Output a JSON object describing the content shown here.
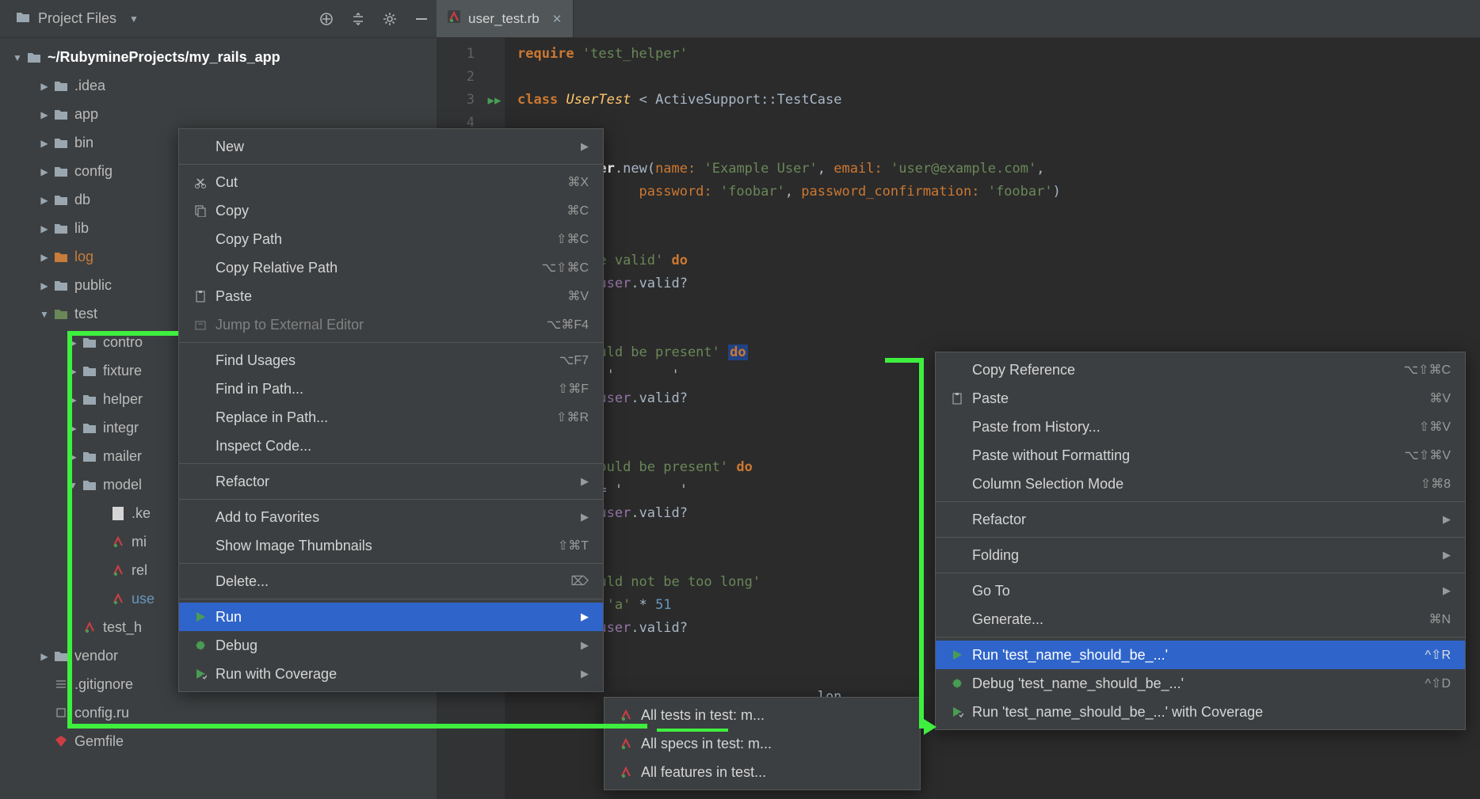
{
  "projectHeader": {
    "title": "Project Files"
  },
  "tree": {
    "root": "~/RubymineProjects/my_rails_app",
    "items": [
      {
        "label": ".idea",
        "depth": 1,
        "arrow": "closed",
        "folder": "grey"
      },
      {
        "label": "app",
        "depth": 1,
        "arrow": "closed",
        "folder": "grey"
      },
      {
        "label": "bin",
        "depth": 1,
        "arrow": "closed",
        "folder": "grey"
      },
      {
        "label": "config",
        "depth": 1,
        "arrow": "closed",
        "folder": "grey"
      },
      {
        "label": "db",
        "depth": 1,
        "arrow": "closed",
        "folder": "grey"
      },
      {
        "label": "lib",
        "depth": 1,
        "arrow": "closed",
        "folder": "grey"
      },
      {
        "label": "log",
        "depth": 1,
        "arrow": "closed",
        "folder": "orange"
      },
      {
        "label": "public",
        "depth": 1,
        "arrow": "closed",
        "folder": "grey"
      },
      {
        "label": "test",
        "depth": 1,
        "arrow": "open",
        "folder": "green"
      },
      {
        "label": "controllers",
        "depth": 2,
        "arrow": "closed",
        "folder": "grey",
        "trunc": "contro"
      },
      {
        "label": "fixtures",
        "depth": 2,
        "arrow": "closed",
        "folder": "grey",
        "trunc": "fixture"
      },
      {
        "label": "helpers",
        "depth": 2,
        "arrow": "closed",
        "folder": "grey",
        "trunc": "helper"
      },
      {
        "label": "integration",
        "depth": 2,
        "arrow": "closed",
        "folder": "grey",
        "trunc": "integr"
      },
      {
        "label": "mailers",
        "depth": 2,
        "arrow": "closed",
        "folder": "grey",
        "trunc": "mailer"
      },
      {
        "label": "models",
        "depth": 2,
        "arrow": "open",
        "folder": "grey",
        "trunc": "model"
      },
      {
        "label": ".keep",
        "depth": 3,
        "arrow": "none",
        "file": "keep",
        "trunc": ".ke"
      },
      {
        "label": "micropost_test.rb",
        "depth": 3,
        "arrow": "none",
        "file": "rb",
        "trunc": "mi"
      },
      {
        "label": "relationship_test.rb",
        "depth": 3,
        "arrow": "none",
        "file": "rb",
        "trunc": "rel"
      },
      {
        "label": "user_test.rb",
        "depth": 3,
        "arrow": "none",
        "file": "rb",
        "trunc": "use",
        "selected": true
      },
      {
        "label": "test_helper.rb",
        "depth": 2,
        "arrow": "none",
        "file": "rb",
        "trunc": "test_h"
      },
      {
        "label": "vendor",
        "depth": 1,
        "arrow": "closed",
        "folder": "grey"
      },
      {
        "label": ".gitignore",
        "depth": 1,
        "arrow": "none",
        "file": "git",
        "trunc": ".gitignore"
      },
      {
        "label": "config.ru",
        "depth": 1,
        "arrow": "none",
        "file": "ru"
      },
      {
        "label": "Gemfile",
        "depth": 1,
        "arrow": "none",
        "file": "gem"
      }
    ]
  },
  "editorTab": {
    "filename": "user_test.rb"
  },
  "code": {
    "lines": [
      "1",
      "2",
      "3",
      "4"
    ]
  },
  "contextMenuLeft": {
    "items": [
      {
        "label": "New",
        "submenu": true
      },
      {
        "sep": true
      },
      {
        "icon": "cut",
        "label": "Cut",
        "shortcut": "⌘X"
      },
      {
        "icon": "copy",
        "label": "Copy",
        "shortcut": "⌘C"
      },
      {
        "label": "Copy Path",
        "shortcut": "⇧⌘C"
      },
      {
        "label": "Copy Relative Path",
        "shortcut": "⌥⇧⌘C"
      },
      {
        "icon": "paste",
        "label": "Paste",
        "shortcut": "⌘V"
      },
      {
        "icon": "external",
        "label": "Jump to External Editor",
        "shortcut": "⌥⌘F4",
        "disabled": true
      },
      {
        "sep": true
      },
      {
        "label": "Find Usages",
        "shortcut": "⌥F7"
      },
      {
        "label": "Find in Path...",
        "shortcut": "⇧⌘F"
      },
      {
        "label": "Replace in Path...",
        "shortcut": "⇧⌘R"
      },
      {
        "label": "Inspect Code..."
      },
      {
        "sep": true
      },
      {
        "label": "Refactor",
        "submenu": true
      },
      {
        "sep": true
      },
      {
        "label": "Add to Favorites",
        "submenu": true
      },
      {
        "label": "Show Image Thumbnails",
        "shortcut": "⇧⌘T"
      },
      {
        "sep": true
      },
      {
        "label": "Delete...",
        "shortcut": "⌦"
      },
      {
        "sep": true
      },
      {
        "icon": "run",
        "label": "Run",
        "submenu": true,
        "selected": true
      },
      {
        "icon": "debug",
        "label": "Debug",
        "submenu": true
      },
      {
        "icon": "coverage",
        "label": "Run with Coverage",
        "submenu": true
      }
    ]
  },
  "runSubmenu": {
    "items": [
      {
        "icon": "rb",
        "label": "All tests in test: m..."
      },
      {
        "icon": "rb",
        "label": "All specs in test: m..."
      },
      {
        "icon": "rb",
        "label": "All features in test..."
      }
    ]
  },
  "contextMenuRight": {
    "items": [
      {
        "label": "Copy Reference",
        "shortcut": "⌥⇧⌘C"
      },
      {
        "icon": "paste",
        "label": "Paste",
        "shortcut": "⌘V"
      },
      {
        "label": "Paste from History...",
        "shortcut": "⇧⌘V"
      },
      {
        "label": "Paste without Formatting",
        "shortcut": "⌥⇧⌘V"
      },
      {
        "label": "Column Selection Mode",
        "shortcut": "⇧⌘8"
      },
      {
        "sep": true
      },
      {
        "label": "Refactor",
        "submenu": true
      },
      {
        "sep": true
      },
      {
        "label": "Folding",
        "submenu": true
      },
      {
        "sep": true
      },
      {
        "label": "Go To",
        "submenu": true
      },
      {
        "label": "Generate...",
        "shortcut": "⌘N"
      },
      {
        "sep": true
      },
      {
        "icon": "run",
        "label": "Run 'test_name_should_be_...'",
        "shortcut": "^⇧R",
        "selected": true
      },
      {
        "icon": "debug",
        "label": "Debug 'test_name_should_be_...'",
        "shortcut": "^⇧D"
      },
      {
        "icon": "coverage",
        "label": "Run 'test_name_should_be_...' with Coverage"
      }
    ]
  }
}
